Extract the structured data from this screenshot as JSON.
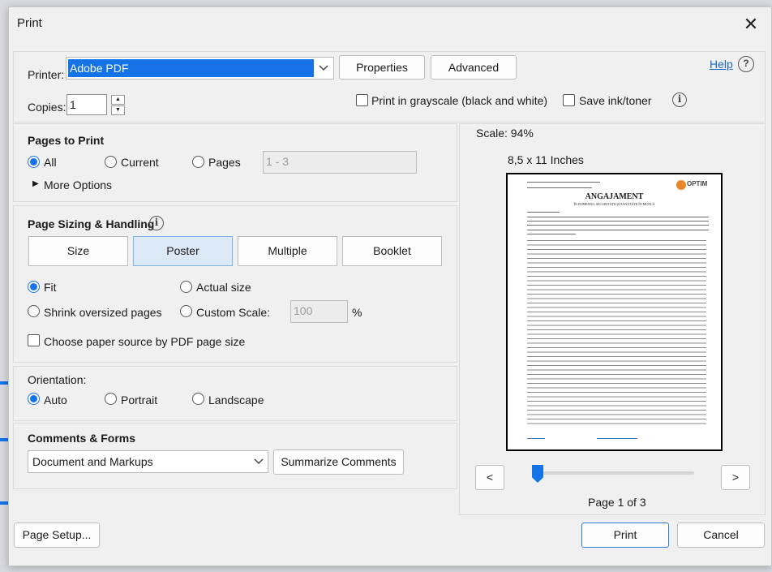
{
  "window": {
    "title": "Print",
    "close_symbol": "✕"
  },
  "printer": {
    "label": "Printer:",
    "selected": "Adobe PDF",
    "properties_label": "Properties",
    "advanced_label": "Advanced",
    "help_label": "Help",
    "help_symbol": "?"
  },
  "copies": {
    "label": "Copies:",
    "value": "1"
  },
  "options": {
    "grayscale_label": "Print in grayscale (black and white)",
    "save_ink_label": "Save ink/toner",
    "info_symbol": "i"
  },
  "pages_to_print": {
    "heading": "Pages to Print",
    "all_label": "All",
    "current_label": "Current",
    "pages_label": "Pages",
    "pages_value": "1 - 3",
    "more_options_label": "More Options",
    "selected": "All"
  },
  "sizing": {
    "heading": "Page Sizing & Handling",
    "tabs": [
      "Size",
      "Poster",
      "Multiple",
      "Booklet"
    ],
    "active_tab": "Poster",
    "fit_label": "Fit",
    "actual_size_label": "Actual size",
    "shrink_label": "Shrink oversized pages",
    "custom_scale_label": "Custom Scale:",
    "custom_scale_value": "100",
    "percent_symbol": "%",
    "paper_source_label": "Choose paper source by PDF page size",
    "selected": "Fit"
  },
  "orientation": {
    "heading": "Orientation:",
    "auto_label": "Auto",
    "portrait_label": "Portrait",
    "landscape_label": "Landscape",
    "selected": "Auto"
  },
  "comments_forms": {
    "heading": "Comments & Forms",
    "selected": "Document and Markups",
    "summarize_label": "Summarize Comments"
  },
  "preview": {
    "scale_text": "Scale:  94%",
    "paper_size": "8,5 x 11 Inches",
    "doc_title": "ANGAJAMENT",
    "doc_subtitle": "ÎN DOMENIUL SECURITĂȚII ȘI SĂNĂTĂȚII ÎN MUNCĂ",
    "doc_logo": "OPTIM",
    "prev_label": "<",
    "next_label": ">",
    "page_indicator": "Page 1 of 3",
    "current_page": 1,
    "total_pages": 3
  },
  "footer": {
    "page_setup_label": "Page Setup...",
    "print_label": "Print",
    "cancel_label": "Cancel"
  },
  "colors": {
    "accent": "#1473e6",
    "selection": "#1473e6",
    "link": "#1a66c4"
  }
}
